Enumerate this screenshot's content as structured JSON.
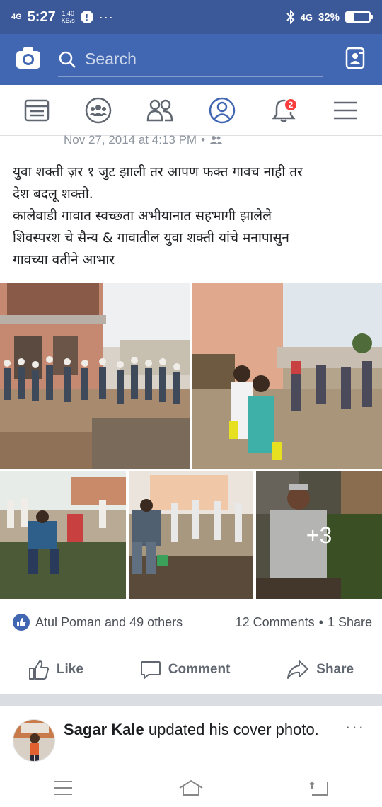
{
  "status_bar": {
    "network": "4G",
    "time": "5:27",
    "speed_value": "1.40",
    "speed_unit": "KB/s",
    "alert_symbol": "!",
    "overflow": "···",
    "network_right": "4G",
    "battery": "32%",
    "battery_level": 0.32
  },
  "header": {
    "search_placeholder": "Search",
    "camera_icon": "camera-icon",
    "messenger_icon": "messenger-icon"
  },
  "nav": {
    "tabs": [
      {
        "name": "news-feed-icon"
      },
      {
        "name": "groups-icon"
      },
      {
        "name": "friends-icon"
      },
      {
        "name": "profile-icon"
      },
      {
        "name": "notifications-icon",
        "badge": "2"
      },
      {
        "name": "menu-icon"
      }
    ]
  },
  "post": {
    "timestamp": "Nov 27, 2014 at 4:13 PM",
    "separator": "•",
    "text_lines": [
      "युवा शक्ती ज़र १ जुट झाली तर आपण फक्त गावच नाही तर",
      "देश बदलू शक्तो.",
      "कालेवाडी गावात स्वच्छता अभीयानात सहभागी झालेले",
      "शिवस्परश चे सैन्य & गावातील युवा शक्ती यांचे मनापासुन",
      "गावच्या वतीने आभार"
    ],
    "more_photos": "+3",
    "reactions_text": "Atul Poman and 49 others",
    "comments": "12 Comments",
    "dot": "•",
    "shares": "1 Share",
    "actions": {
      "like": "Like",
      "comment": "Comment",
      "share": "Share"
    }
  },
  "next_story": {
    "author": "Sagar Kale",
    "action": " updated his cover photo.",
    "more": "···"
  },
  "colors": {
    "brand": "#4267b2",
    "status_bar": "#3b5998",
    "badge": "#fa3e3e"
  }
}
